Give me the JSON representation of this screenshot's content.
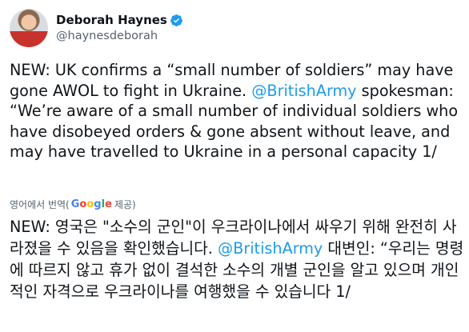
{
  "author": {
    "display_name": "Deborah Haynes",
    "handle": "@haynesdeborah",
    "verified_icon": "verified-badge-icon"
  },
  "tweet": {
    "text_before_mention": "NEW: UK confirms a “small number of soldiers” may have gone AWOL to fight in Ukraine. ",
    "mention": "@BritishArmy",
    "text_after_mention": " spokesman: “We’re aware of a small number of individual soldiers who have disobeyed orders & gone absent without leave, and may have travelled to Ukraine in a personal capacity 1/"
  },
  "translation": {
    "prefix": "영어에서 번역(",
    "google": [
      "G",
      "o",
      "o",
      "g",
      "l",
      "e"
    ],
    "suffix": " 제공)",
    "text_before_mention": "NEW: 영국은 \"소수의 군인\"이 우크라이나에서 싸우기 위해 완전히 사라졌을 수 있음을 확인했습니다. ",
    "mention": "@BritishArmy",
    "text_after_mention": " 대변인: “우리는 명령에 따르지 않고 휴가 없이 결석한 소수의 개별 군인을 알고 있으며 개인적인 자격으로 우크라이나를 여행했을 수 있습니다 1/"
  },
  "colors": {
    "link": "#1d9bf0",
    "verified": "#1d9bf0",
    "secondary_text": "#536471"
  }
}
